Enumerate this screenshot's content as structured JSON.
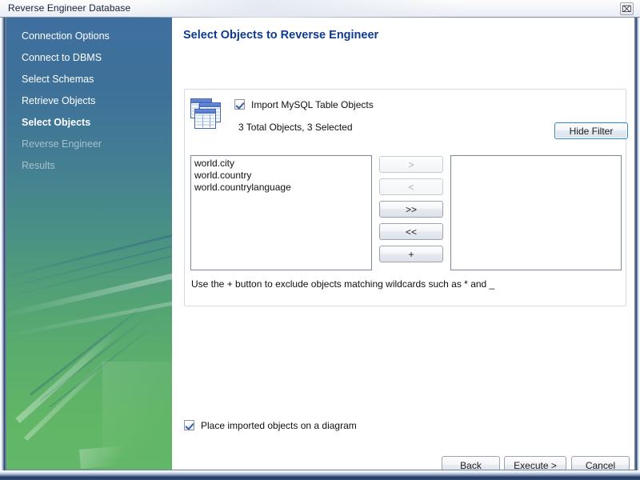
{
  "window": {
    "title": "Reverse Engineer Database",
    "close_glyph": "⌧",
    "close_label": "Close"
  },
  "sidebar": {
    "items": [
      {
        "label": "Connection Options",
        "state": "done"
      },
      {
        "label": "Connect to DBMS",
        "state": "done"
      },
      {
        "label": "Select Schemas",
        "state": "done"
      },
      {
        "label": "Retrieve Objects",
        "state": "done"
      },
      {
        "label": "Select Objects",
        "state": "active"
      },
      {
        "label": "Reverse Engineer",
        "state": "disabled"
      },
      {
        "label": "Results",
        "state": "disabled"
      }
    ]
  },
  "content": {
    "page_title": "Select Objects to Reverse Engineer",
    "filter_panel": {
      "icon_name": "stacked-tables-icon",
      "import_checkbox": {
        "label": "Import MySQL Table Objects",
        "checked": true
      },
      "totals_text": "3 Total Objects, 3 Selected",
      "hide_filter_label": "Hide Filter",
      "left_list": {
        "items": [
          "world.city",
          "world.country",
          "world.countrylanguage"
        ]
      },
      "right_list": {
        "items": []
      },
      "transfer_buttons": [
        {
          "label": ">",
          "enabled": false
        },
        {
          "label": "<",
          "enabled": false
        },
        {
          "label": ">>",
          "enabled": true
        },
        {
          "label": "<<",
          "enabled": true
        },
        {
          "label": "+",
          "enabled": true
        }
      ],
      "hint": "Use the + button to exclude objects matching wildcards such as * and _"
    },
    "diagram_checkbox": {
      "label": "Place imported objects on a diagram",
      "checked": true
    },
    "footer": {
      "back_label": "Back",
      "execute_label": "Execute >",
      "cancel_label": "Cancel"
    }
  },
  "colors": {
    "sidebar_top": "#3f6f9f",
    "sidebar_bottom": "#63b768",
    "title_accent": "#103a8e",
    "focus_border": "#2f87cf"
  }
}
